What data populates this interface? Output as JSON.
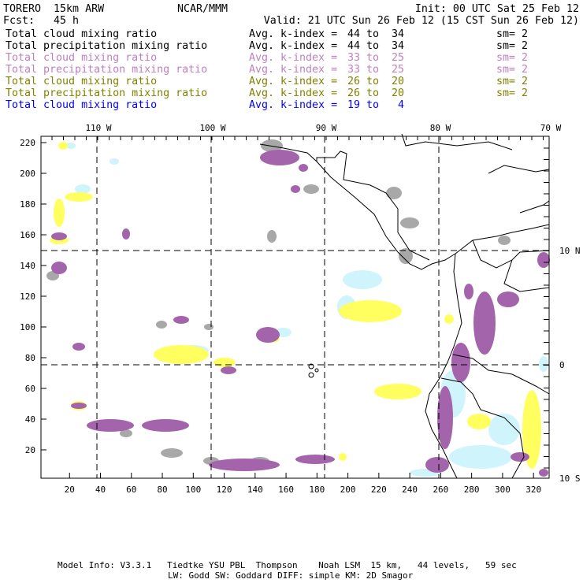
{
  "header": {
    "model": "TORERO  15km ARW",
    "org": "NCAR/MMM",
    "init": "Init: 00 UTC Sat 25 Feb 12",
    "fcst": "Fcst:   45 h",
    "valid": "Valid: 21 UTC Sun 26 Feb 12 (15 CST Sun 26 Feb 12)"
  },
  "legend": [
    {
      "field": "Total cloud mixing ratio",
      "index": "Avg. k-index =",
      "range": "44 to  34",
      "sm": "sm= 2",
      "color": "#000000"
    },
    {
      "field": "Total precipitation mixing ratio",
      "index": "Avg. k-index =",
      "range": "44 to  34",
      "sm": "sm= 2",
      "color": "#000000"
    },
    {
      "field": "Total cloud mixing ratio",
      "index": "Avg. k-index =",
      "range": "33 to  25",
      "sm": "sm= 2",
      "color": "#c080c0"
    },
    {
      "field": "Total precipitation mixing ratio",
      "index": "Avg. k-index =",
      "range": "33 to  25",
      "sm": "sm= 2",
      "color": "#c080c0"
    },
    {
      "field": "Total cloud mixing ratio",
      "index": "Avg. k-index =",
      "range": "26 to  20",
      "sm": "sm= 2",
      "color": "#808000"
    },
    {
      "field": "Total precipitation mixing ratio",
      "index": "Avg. k-index =",
      "range": "26 to  20",
      "sm": "sm= 2",
      "color": "#808000"
    },
    {
      "field": "Total cloud mixing ratio",
      "index": "Avg. k-index =",
      "range": "19 to   4",
      "sm": "",
      "color": "#0000ff"
    }
  ],
  "map": {
    "lon_labels": [
      "110 W",
      "100 W",
      "90 W",
      "80 W",
      "70 W"
    ],
    "lat_labels": [
      "10 N",
      "0",
      "10 S"
    ],
    "x_ticks": [
      "20",
      "40",
      "60",
      "80",
      "100",
      "120",
      "140",
      "160",
      "180",
      "200",
      "220",
      "240",
      "260",
      "280",
      "300",
      "320"
    ],
    "y_ticks": [
      "20",
      "40",
      "60",
      "80",
      "100",
      "120",
      "140",
      "160",
      "180",
      "200",
      "220"
    ],
    "colors": {
      "gray": "#a8a8a8",
      "purple": "#a464ac",
      "yellow": "#ffff60",
      "lightblue": "#d0f4fc"
    }
  },
  "footer": {
    "line1": "Model Info: V3.3.1   Tiedtke YSU PBL  Thompson    Noah LSM  15 km,   44 levels,   59 sec",
    "line2": "LW: Godd SW: Goddard DIFF: simple KM: 2D Smagor"
  }
}
